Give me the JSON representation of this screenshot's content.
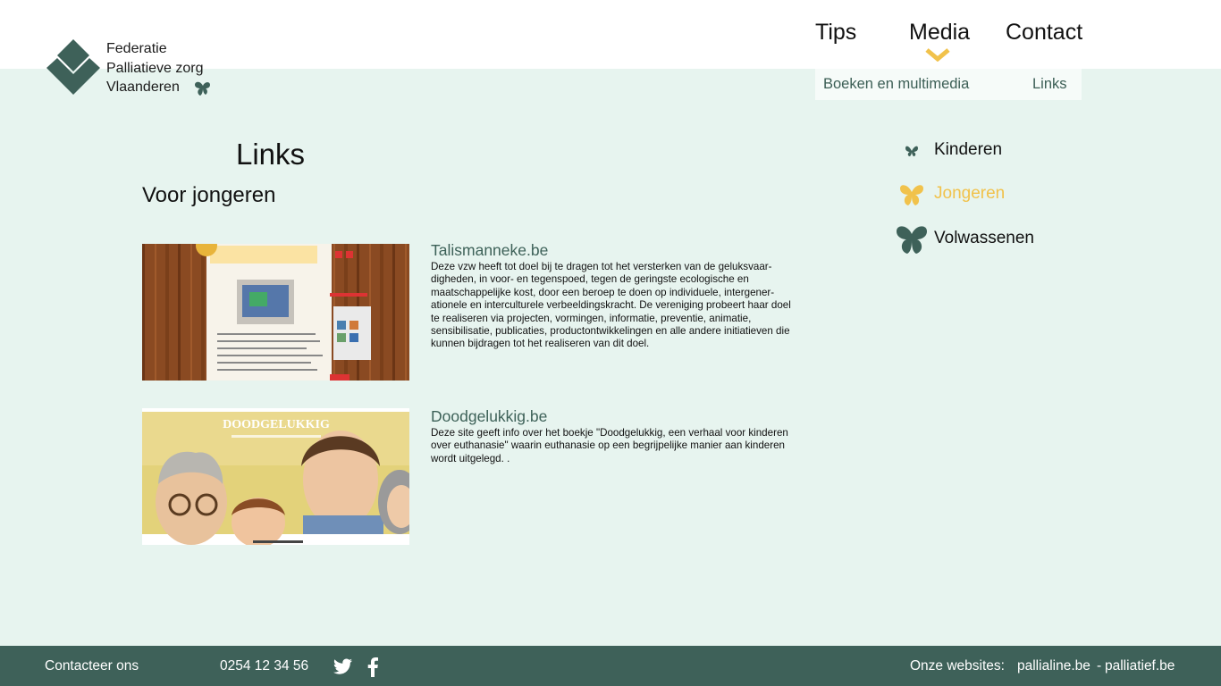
{
  "brand": {
    "line1": "Federatie",
    "line2": "Palliatieve zorg",
    "line3": "Vlaanderen",
    "logo_icon": "diamond-chevron-logo",
    "color_primary": "#3e6159",
    "color_accent": "#f1c24b",
    "color_bg": "#e7f4ef"
  },
  "nav": {
    "tips": "Tips",
    "media": "Media",
    "contact": "Contact",
    "active": "Media"
  },
  "submenu": {
    "books": "Boeken en multimedia",
    "links": "Links"
  },
  "main": {
    "title": "Links",
    "section": "Voor jongeren",
    "items": [
      {
        "title": "Talismanneke.be",
        "description": "Deze vzw heeft tot doel bij te dragen tot het versterken van de geluksvaar-digheden, in voor- en tegenspoed, tegen de geringste ecologische en maatschappelijke kost, door een beroep te doen op individuele, intergener-ationele en interculturele verbeeldingskracht. De vereniging probeert haar doel te realiseren via projecten, vormingen, informatie, preventie, animatie, sensibilisatie, publicaties, productontwikkelingen en alle andere initiatieven die kunnen bijdragen tot het realiseren van dit doel."
      },
      {
        "title": "Doodgelukkig.be",
        "description": "Deze site geeft info over het boekje \"Doodgelukkig, een verhaal voor kinderen over euthanasie\" waarin euthanasie op een begrijpelijke manier aan kinderen wordt uitgelegd. .",
        "image_text": "DOODGELUKKIG"
      }
    ]
  },
  "categories": [
    {
      "label": "Kinderen",
      "icon": "butterfly-small-icon",
      "color": "#3e6159",
      "active": false
    },
    {
      "label": "Jongeren",
      "icon": "butterfly-medium-icon",
      "color": "#f1c24b",
      "active": true
    },
    {
      "label": "Volwassenen",
      "icon": "butterfly-large-icon",
      "color": "#3e6159",
      "active": false
    }
  ],
  "footer": {
    "contact": "Contacteer ons",
    "phone": "0254 12 34 56",
    "twitter_icon": "twitter-icon",
    "facebook_icon": "facebook-icon",
    "websites_label": "Onze websites:",
    "site1": "pallialine.be",
    "separator": "-",
    "site2": "palliatief.be"
  }
}
